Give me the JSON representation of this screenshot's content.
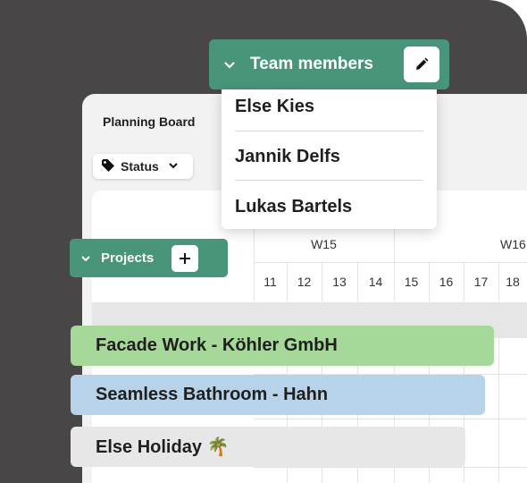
{
  "board": {
    "title": "Planning Board"
  },
  "status_filter": {
    "label": "Status"
  },
  "team_members": {
    "label": "Team members",
    "members": [
      "Else Kies",
      "Jannik Delfs",
      "Lukas Bartels"
    ]
  },
  "projects": {
    "label": "Projects"
  },
  "calendar": {
    "weeks": [
      "W15",
      "W16"
    ],
    "days": [
      "11",
      "12",
      "13",
      "14",
      "15",
      "16",
      "17",
      "18"
    ]
  },
  "bars": [
    {
      "label": "Facade Work - Köhler GmbH",
      "color": "#a6d89a"
    },
    {
      "label": "Seamless Bathroom - Hahn",
      "color": "#b6d3ea"
    },
    {
      "label": "Else Holiday 🌴",
      "color": "#e7e7e7"
    }
  ],
  "colors": {
    "accent": "#48957a",
    "background": "#484646"
  },
  "icons": [
    "tag-icon",
    "chevron-down-icon",
    "plus-icon",
    "pencil-icon"
  ]
}
